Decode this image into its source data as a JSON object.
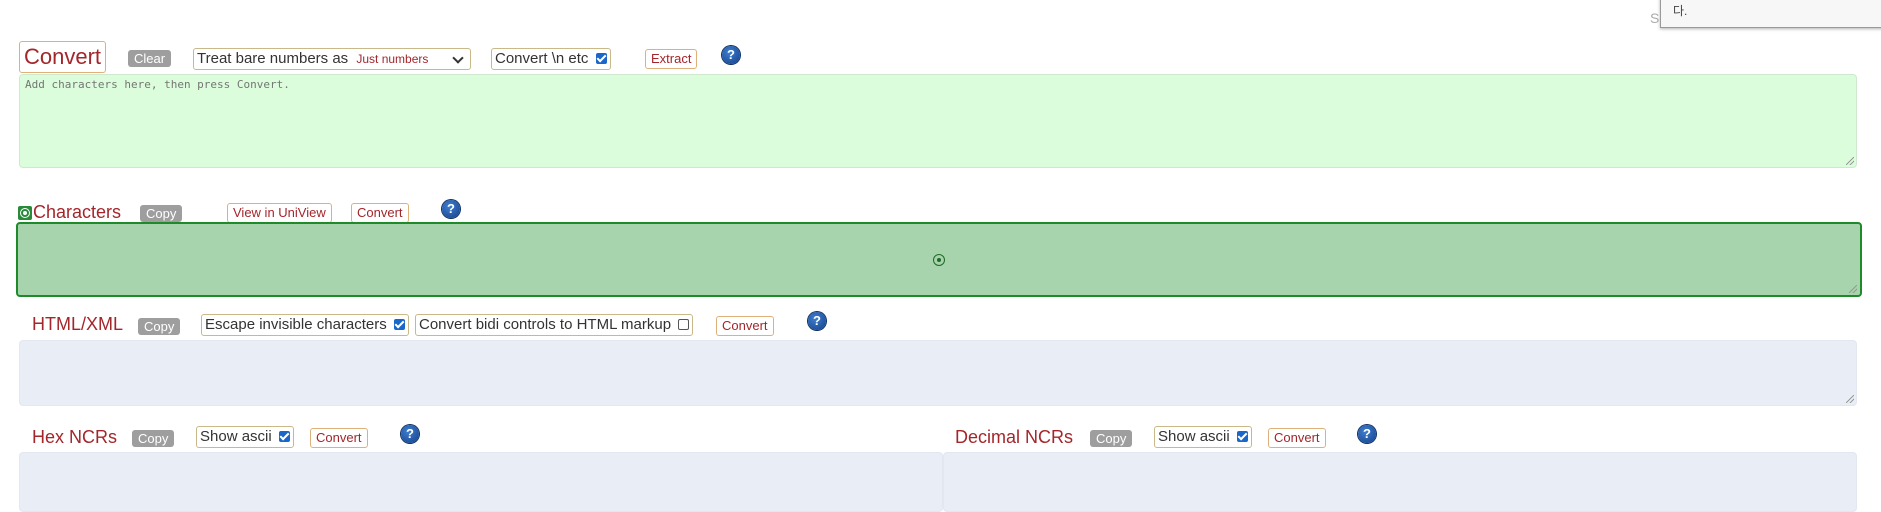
{
  "convert_section": {
    "title": "Convert",
    "clear_label": "Clear",
    "treat_label": "Treat bare numbers as",
    "treat_selected": "Just numbers",
    "convert_n_label": "Convert \\n etc",
    "convert_n_checked": true,
    "extract_label": "Extract",
    "input_placeholder": "Add characters here, then press Convert."
  },
  "characters_section": {
    "title": "Characters",
    "copy_label": "Copy",
    "uniview_label": "View in UniView",
    "convert_label": "Convert"
  },
  "html_section": {
    "title": "HTML/XML",
    "copy_label": "Copy",
    "escape_label": "Escape invisible characters",
    "escape_checked": true,
    "bidi_label": "Convert bidi controls to HTML markup",
    "bidi_checked": false,
    "convert_label": "Convert"
  },
  "hex_section": {
    "title": "Hex NCRs",
    "copy_label": "Copy",
    "show_ascii_label": "Show ascii",
    "show_ascii_checked": true,
    "convert_label": "Convert"
  },
  "decimal_section": {
    "title": "Decimal NCRs",
    "copy_label": "Copy",
    "show_ascii_label": "Show ascii",
    "show_ascii_checked": true,
    "convert_label": "Convert"
  },
  "help_icon_glyph": "?",
  "corner_tooltip": {
    "text": "다.",
    "partial_letter": "S"
  },
  "colors": {
    "accent_red": "#a3262b",
    "input_green": "#dcfddc",
    "characters_green": "#a7d3ad",
    "characters_border": "#1e8a2a",
    "neutral_field": "#e9edf6"
  }
}
